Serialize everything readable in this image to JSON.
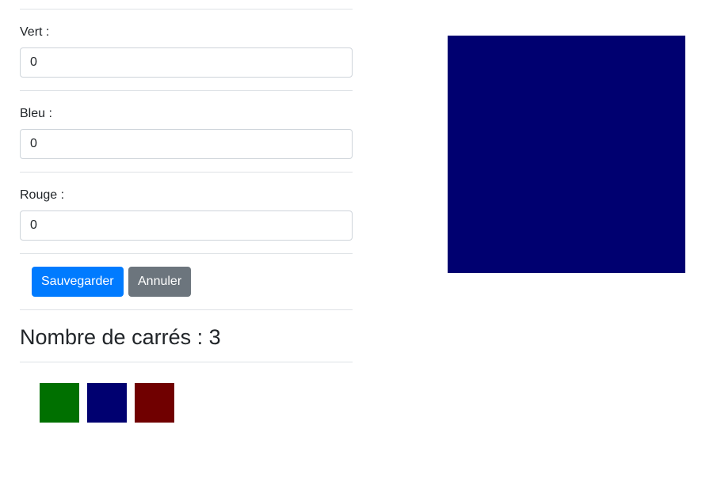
{
  "form": {
    "green": {
      "label": "Vert :",
      "value": "0"
    },
    "blue": {
      "label": "Bleu :",
      "value": "0"
    },
    "red": {
      "label": "Rouge :",
      "value": "0"
    },
    "save_label": "Sauvegarder",
    "cancel_label": "Annuler"
  },
  "squares": {
    "count_text": "Nombre de carrés : 3",
    "items": [
      {
        "color": "#007000"
      },
      {
        "color": "#000070"
      },
      {
        "color": "#700000"
      }
    ]
  },
  "preview": {
    "color": "#000070"
  },
  "colors": {
    "primary": "#007bff",
    "secondary": "#6c757d"
  }
}
